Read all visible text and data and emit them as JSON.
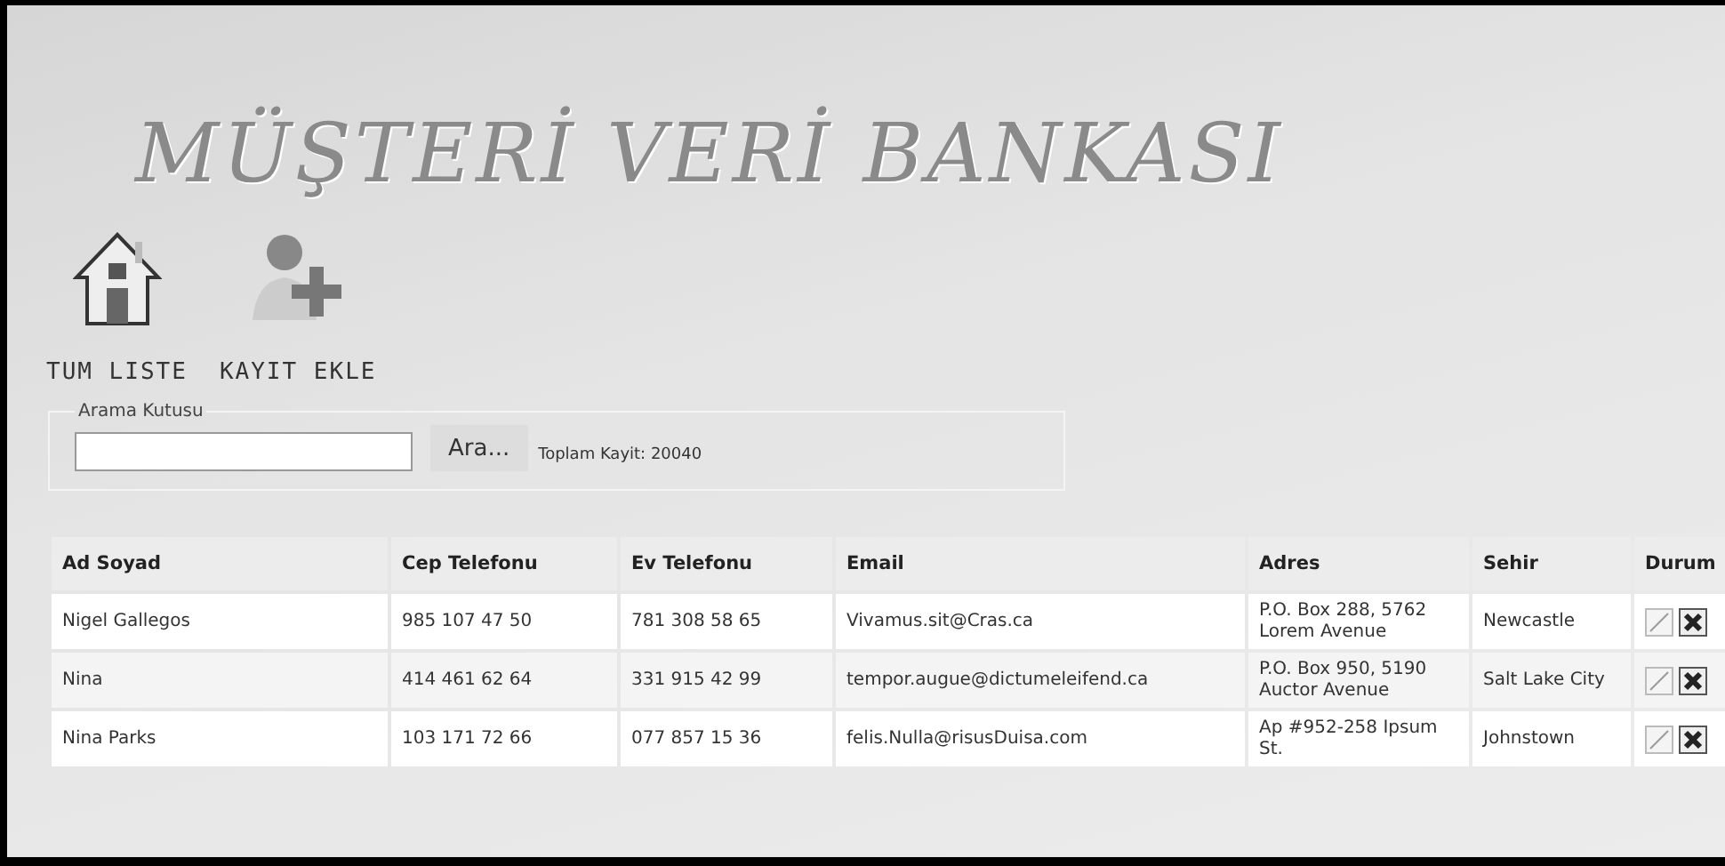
{
  "title": "MÜŞTERİ VERİ BANKASI",
  "nav": [
    {
      "kind": "home",
      "label": "TUM LISTE"
    },
    {
      "kind": "add-user",
      "label": "KAYIT EKLE"
    }
  ],
  "search": {
    "legend": "Arama Kutusu",
    "button": "Ara...",
    "total": "Toplam Kayit: 20040"
  },
  "table": {
    "columns": [
      "Ad Soyad",
      "Cep Telefonu",
      "Ev Telefonu",
      "Email",
      "Adres",
      "Sehir",
      "Durum"
    ],
    "rows": [
      {
        "cells": [
          "Nigel Gallegos",
          "985 107 47 50",
          "781 308 58 65",
          "Vivamus.sit@Cras.ca",
          "P.O. Box 288, 5762 Lorem Avenue",
          "Newcastle"
        ]
      },
      {
        "cells": [
          "Nina",
          "414 461 62 64",
          "331 915 42 99",
          "tempor.augue@dictumeleifend.ca",
          "P.O. Box 950, 5190 Auctor Avenue",
          "Salt Lake City"
        ]
      },
      {
        "cells": [
          "Nina Parks",
          "103 171 72 66",
          "077 857 15 36",
          "felis.Nulla@risusDuisa.com",
          "Ap #952-258 Ipsum St.",
          "Johnstown"
        ]
      }
    ]
  }
}
